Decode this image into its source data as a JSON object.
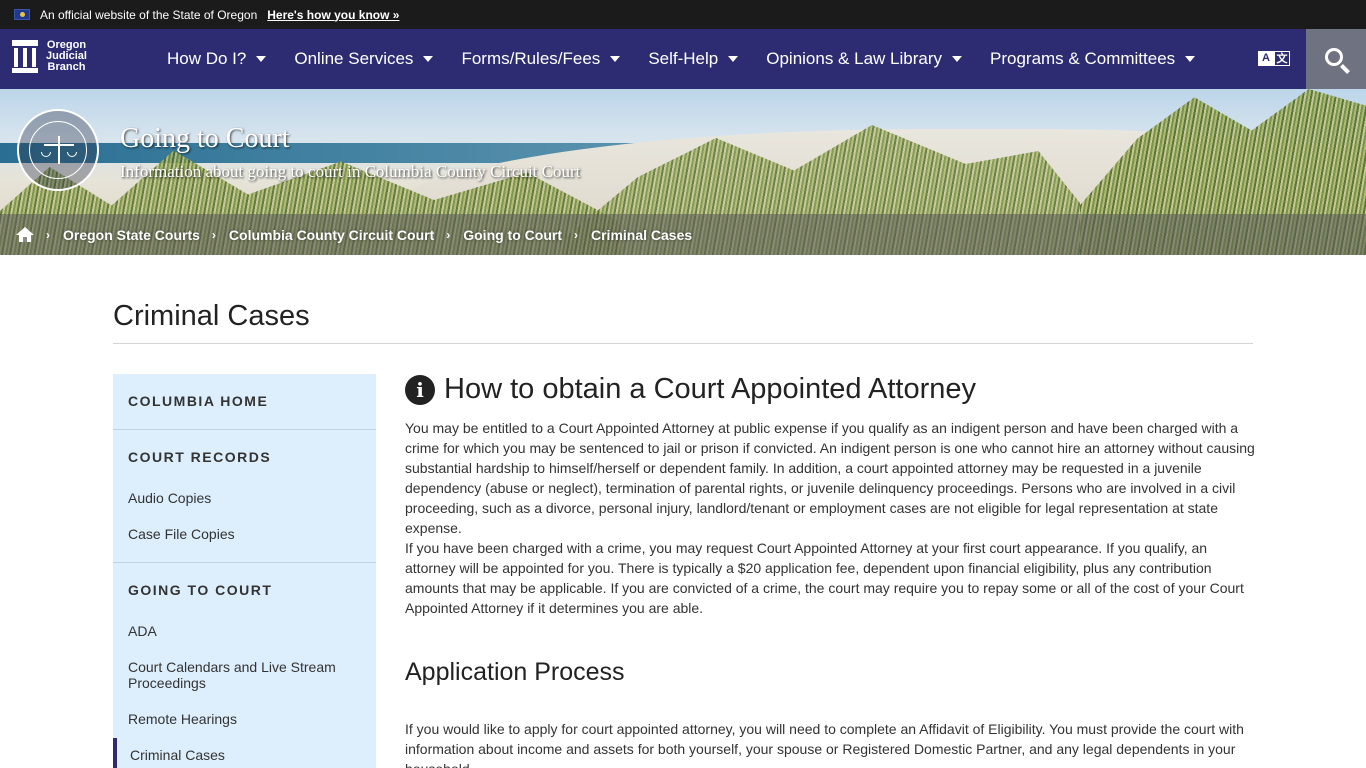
{
  "gov_banner": {
    "text": "An official website of the State of Oregon",
    "link": "Here's how you know »"
  },
  "logo": {
    "lines": [
      "Oregon",
      "Judicial",
      "Branch"
    ]
  },
  "nav": {
    "items": [
      {
        "label": "How Do I?"
      },
      {
        "label": "Online Services"
      },
      {
        "label": "Forms/Rules/Fees"
      },
      {
        "label": "Self-Help"
      },
      {
        "label": "Opinions & Law Library"
      },
      {
        "label": "Programs & Committees"
      }
    ],
    "translate_a": "A",
    "translate_b": "文",
    "search_icon": "search-icon"
  },
  "hero": {
    "title": "Going to Court",
    "subtitle": "Information about going to court in Columbia County Circuit Court",
    "seal_icon": "judicial-department-seal"
  },
  "breadcrumb": {
    "separator": "›",
    "items": [
      {
        "label": "Oregon State Courts"
      },
      {
        "label": "Columbia County Circuit Court"
      },
      {
        "label": "Going to Court"
      },
      {
        "label": "Criminal Cases"
      }
    ]
  },
  "page": {
    "title": "Criminal Cases"
  },
  "sidebar": {
    "sections": [
      {
        "heading": "COLUMBIA HOME",
        "links": []
      },
      {
        "heading": "COURT RECORDS",
        "links": [
          "Audio Copies",
          "Case File Copies"
        ]
      },
      {
        "heading": "GOING TO COURT",
        "links": [
          "ADA",
          "Court Calendars and Live Stream Proceedings",
          "Remote Hearings",
          "Criminal Cases"
        ]
      }
    ],
    "active": "Criminal Cases"
  },
  "content": {
    "heading": "How to obtain a Court Appointed Attorney",
    "info_icon": "info-circle-icon",
    "para1": "You may be entitled to a Court Appointed Attorney at public expense if you qualify as an indigent person and have been charged with a crime for which you may be sentenced to jail or prison if convicted. An indigent person is one who cannot hire an attorney without causing substantial hardship to himself/herself or dependent family. In addition, a court appointed attorney may be requested in a juvenile dependency (abuse or neglect), termination of parental rights, or juvenile delinquency proceedings. Persons who are involved in a civil proceeding, such as a divorce, personal injury, landlord/tenant or employment cases are not eligible for legal representation at state expense.",
    "para2": "If you have been charged with a crime, you may request Court Appointed Attorney at your first court appearance. If you qualify, an attorney will be appointed for you. There is typically a $20 application fee, dependent upon financial eligibility, plus any contribution amounts that may be applicable. If you are convicted of a crime, the court may require you to repay some or all of the cost of your Court Appointed Attorney if it determines you are able.",
    "subheading": "Application Process",
    "para3": "If you would like to apply for court appointed attorney, you will need to complete an Affidavit   of Eligibility. You must provide the court with information about income and assets for both yourself, your spouse or Registered Domestic Partner, and any legal dependents in your household."
  }
}
